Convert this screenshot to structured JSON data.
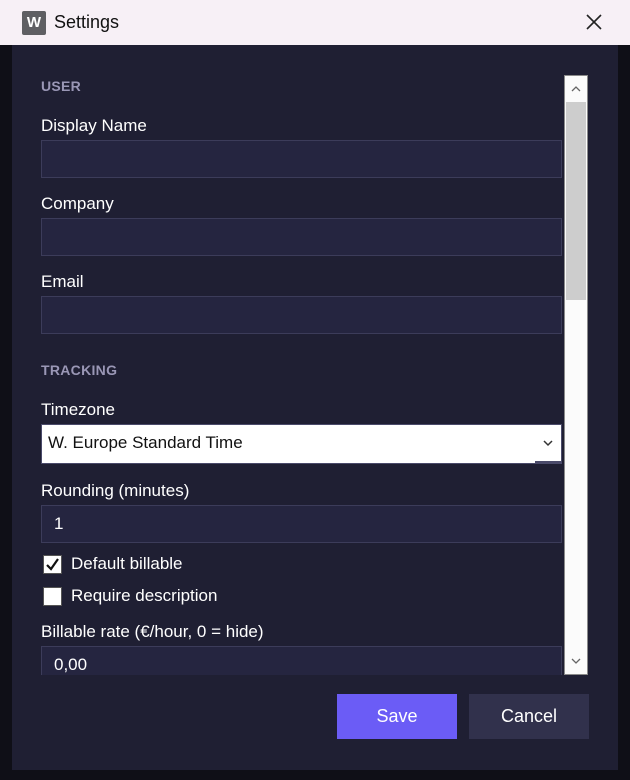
{
  "window": {
    "title": "Settings",
    "app_icon_letter": "W"
  },
  "sections": {
    "user": "USER",
    "tracking": "TRACKING"
  },
  "fields": {
    "display_name": {
      "label": "Display Name",
      "value": ""
    },
    "company": {
      "label": "Company",
      "value": ""
    },
    "email": {
      "label": "Email",
      "value": ""
    },
    "timezone": {
      "label": "Timezone",
      "selected": "W. Europe Standard Time"
    },
    "rounding": {
      "label": "Rounding (minutes)",
      "value": "1"
    },
    "default_billable": {
      "label": "Default billable",
      "checked": true
    },
    "require_description": {
      "label": "Require description",
      "checked": false
    },
    "billable_rate": {
      "label": "Billable rate (€/hour, 0 = hide)",
      "value": "0,00"
    }
  },
  "buttons": {
    "save": "Save",
    "cancel": "Cancel"
  },
  "colors": {
    "accent": "#6b5cf6",
    "background": "#1f1f33",
    "input": "#252540"
  },
  "icons": {
    "close": "close-icon",
    "dropdown": "chevron-down-icon",
    "check": "checkmark-icon"
  }
}
